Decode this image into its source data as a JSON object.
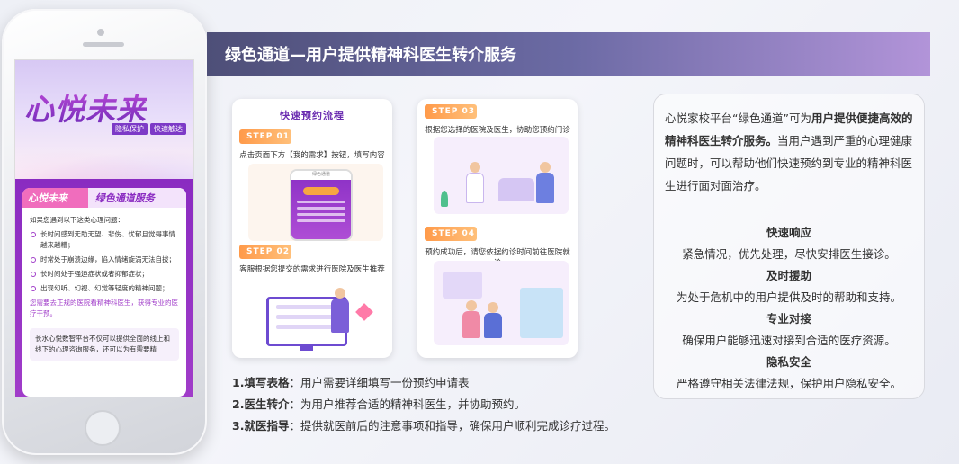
{
  "header": {
    "title": "绿色通道—用户提供精神科医生转介服务"
  },
  "phone": {
    "logo": "心悦未来",
    "tags": [
      "隐私保护",
      "快速触达"
    ],
    "card_left": "心悦未来",
    "card_right": "绿色通道服务",
    "intro": "如果您遇到以下这类心理问题：",
    "bullets": [
      "长时间感到无助无望、悲伤、忧郁且觉得事情越来越糟；",
      "时常处于崩溃边缘，陷入情绪旋涡无法自拔；",
      "长时间处于强迫症状或者抑郁症状；",
      "出现幻听、幻视、幻觉等轻度的精神问题；"
    ],
    "advice": "您需要去正规的医院看精神科医生，获得专业的医疗干预。",
    "tail": "长水心悦数智平台不仅可以提供全面的线上和线下的心理咨询服务，还可以为有需要精"
  },
  "card1": {
    "title": "快速预约流程",
    "step1_badge": "STEP 01",
    "step1_text": "点击页面下方【我的需求】按钮，填写内容",
    "mini_phone_title": "绿色通道",
    "step2_badge": "STEP 02",
    "step2_text": "客服根据您提交的需求进行医院及医生推荐"
  },
  "card2": {
    "step3_badge": "STEP 03",
    "step3_text": "根据您选择的医院及医生，协助您预约门诊",
    "step4_badge": "STEP 04",
    "step4_text": "预约成功后，请您依据约诊时间前往医院就诊"
  },
  "steps_list": [
    {
      "num": "1.",
      "title": "填写表格",
      "desc": "：用户需要详细填写一份预约申请表"
    },
    {
      "num": "2.",
      "title": "医生转介",
      "desc": "：为用户推荐合适的精神科医生，并协助预约。"
    },
    {
      "num": "3.",
      "title": "就医指导",
      "desc": "：提供就医前后的注意事项和指导，确保用户顺利完成诊疗过程。"
    }
  ],
  "info": {
    "intro_pre": "心悦家校平台“绿色通道”可为",
    "intro_bold": "用户提供便捷高效的精神科医生转介服务。",
    "intro_post": "当用户遇到严重的心理健康问题时，可以帮助他们快速预约到专业的精神科医生进行面对面治疗。",
    "features": [
      {
        "title": "快速响应",
        "desc": "紧急情况，优先处理，尽快安排医生接诊。"
      },
      {
        "title": "及时援助",
        "desc": "为处于危机中的用户提供及时的帮助和支持。"
      },
      {
        "title": "专业对接",
        "desc": "确保用户能够迅速对接到合适的医疗资源。"
      },
      {
        "title": "隐私安全",
        "desc": "严格遵守相关法律法规，保护用户隐私安全。"
      }
    ]
  }
}
